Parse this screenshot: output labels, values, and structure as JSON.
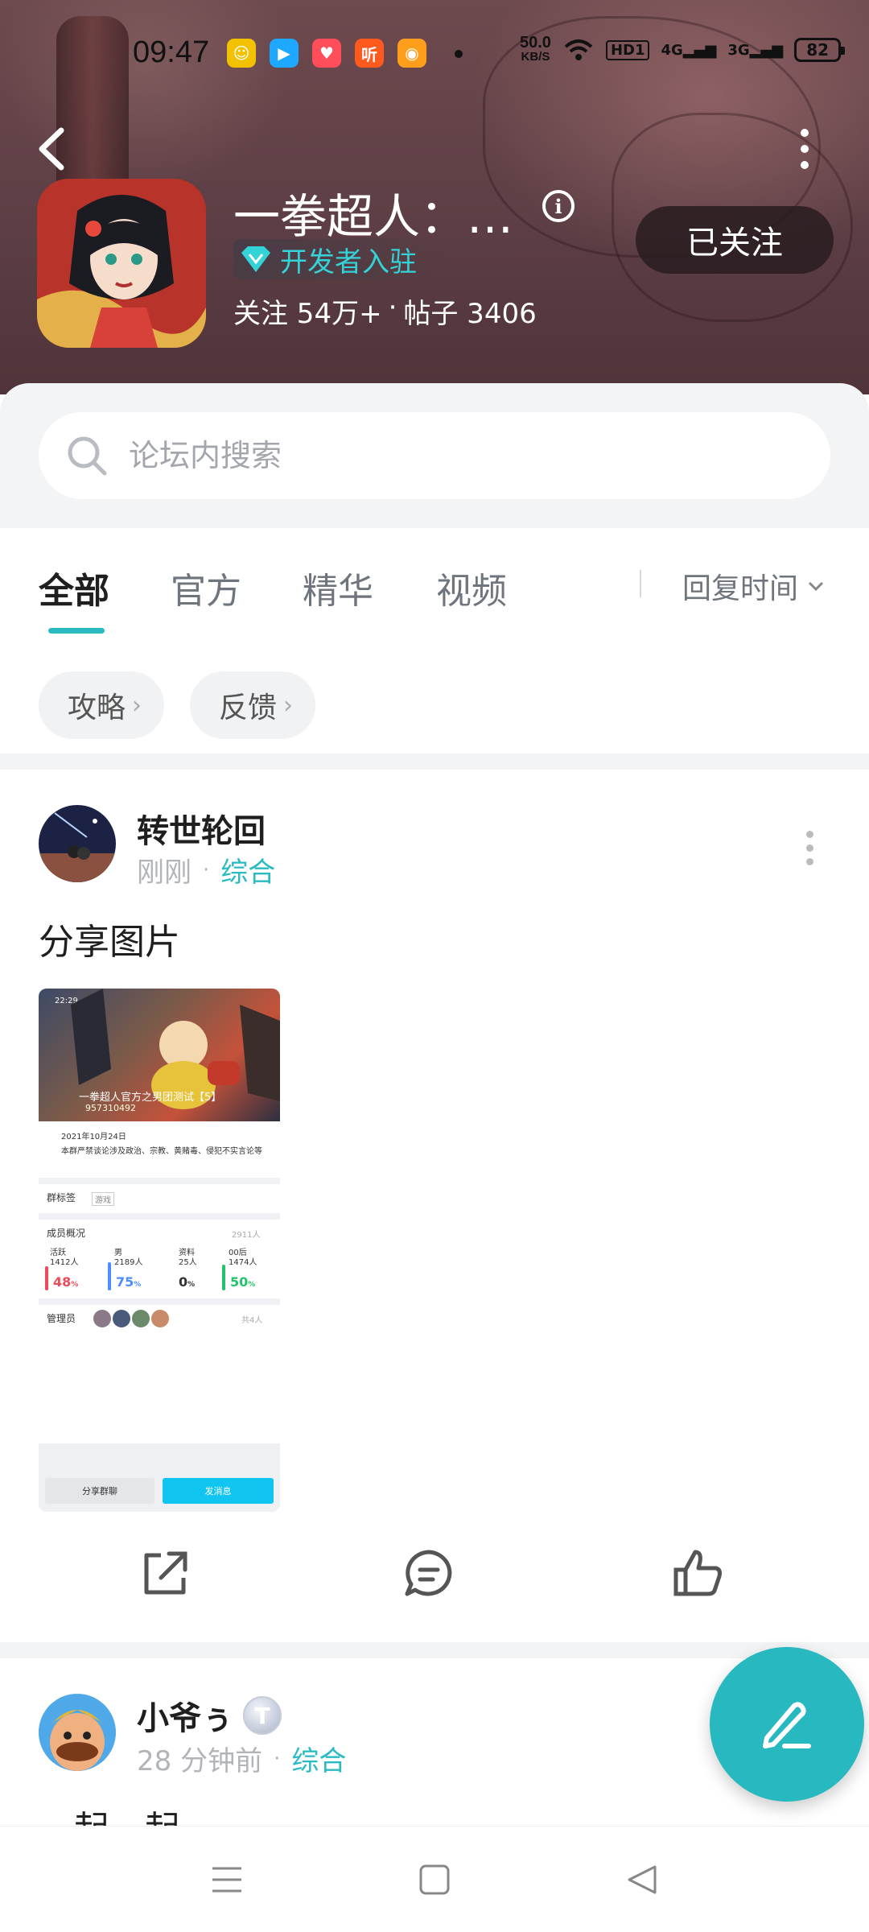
{
  "status_bar": {
    "time": "09:47",
    "net_speed_value": "50.0",
    "net_speed_unit": "KB/S",
    "hd_label": "HD",
    "hd_sub": "1",
    "signal1_label": "4G",
    "signal2_label": "3G",
    "battery": "82",
    "apps": [
      {
        "icon": "ticket-app-icon",
        "glyph": "☺",
        "color": "#f2c200"
      },
      {
        "icon": "youku-app-icon",
        "glyph": "▶",
        "color": "#1ea8ff"
      },
      {
        "icon": "pig-app-icon",
        "glyph": "♥",
        "color": "#ff4d5a"
      },
      {
        "icon": "listen-app-icon",
        "glyph": "听",
        "color": "#ff5a1e"
      },
      {
        "icon": "weibo-app-icon",
        "glyph": "◉",
        "color": "#ff9e1a"
      }
    ]
  },
  "header": {
    "title": "一拳超人：…",
    "developer_badge": "开发者入驻",
    "followers_label": "关注 54万+",
    "dot_sep": "·",
    "posts_label": "帖子 3406",
    "follow_button": "已关注"
  },
  "search": {
    "placeholder": "论坛内搜索"
  },
  "tabs": [
    {
      "label": "全部",
      "active": true
    },
    {
      "label": "官方",
      "active": false
    },
    {
      "label": "精华",
      "active": false
    },
    {
      "label": "视频",
      "active": false
    }
  ],
  "sort": {
    "label": "回复时间"
  },
  "chips": [
    {
      "label": "攻略"
    },
    {
      "label": "反馈"
    }
  ],
  "posts": [
    {
      "author": "转世轮回",
      "time": "刚刚",
      "sep": "·",
      "category": "综合",
      "text": "分享图片",
      "screenshot": {
        "time": "22:29",
        "title": "一拳超人官方之男团测试【5】",
        "id": "957310492",
        "date": "2021年10月24日",
        "desc": "本群严禁谈论涉及政治、宗教、黄赌毒、侵犯不实言论等",
        "tag_label": "群标签",
        "tag_value": "游戏",
        "members_label": "成员概况",
        "members_count": "2911人",
        "stats": [
          {
            "label": "活跃",
            "sub": "1412人",
            "pct": "48",
            "color": "#ec4b5a"
          },
          {
            "label": "男",
            "sub": "2189人",
            "pct": "75",
            "color": "#4c8dff"
          },
          {
            "label": "资料",
            "sub": "25人",
            "pct": "0",
            "color": "#333333"
          },
          {
            "label": "00后",
            "sub": "1474人",
            "pct": "50",
            "color": "#22c36a"
          }
        ],
        "pct_unit": "%",
        "admins_label": "管理员",
        "admins_count": "共4人",
        "btn_share": "分享群聊",
        "btn_send": "发消息"
      }
    },
    {
      "author": "小爷ぅ",
      "level_badge": "T",
      "time": "28 分钟前",
      "sep": "·",
      "category": "综合",
      "text": "一起一起"
    }
  ],
  "colors": {
    "accent": "#2bbac2",
    "header_bg": "#5d3f45",
    "fab": "#27b8c0"
  }
}
